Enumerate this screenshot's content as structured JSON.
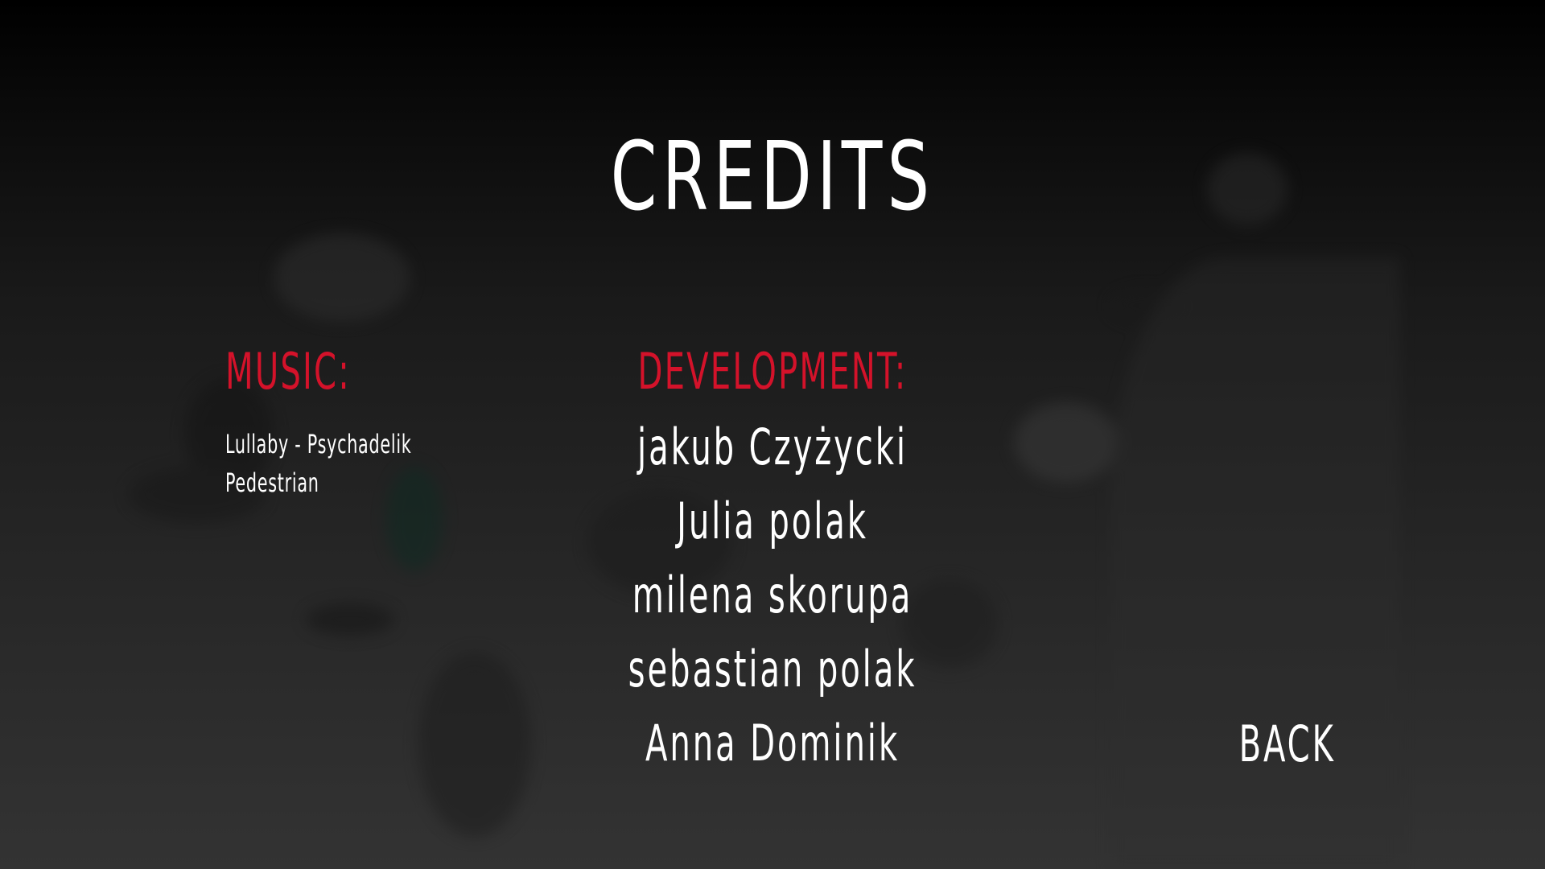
{
  "screen": {
    "title": "CREDITS"
  },
  "music": {
    "heading": "MUSIC:",
    "tracks": [
      "Lullaby - Psychadelik",
      "Pedestrian"
    ]
  },
  "development": {
    "heading": "DEVELOPMENT:",
    "members": [
      "jakub Czyżycki",
      "Julia polak",
      "milena skorupa",
      "sebastian polak",
      "Anna Dominik"
    ]
  },
  "buttons": {
    "back_label": "BACK"
  },
  "colors": {
    "heading_accent": "#d4122a",
    "text": "#ffffff",
    "background_top": "#000000",
    "background_bottom": "#333333"
  }
}
